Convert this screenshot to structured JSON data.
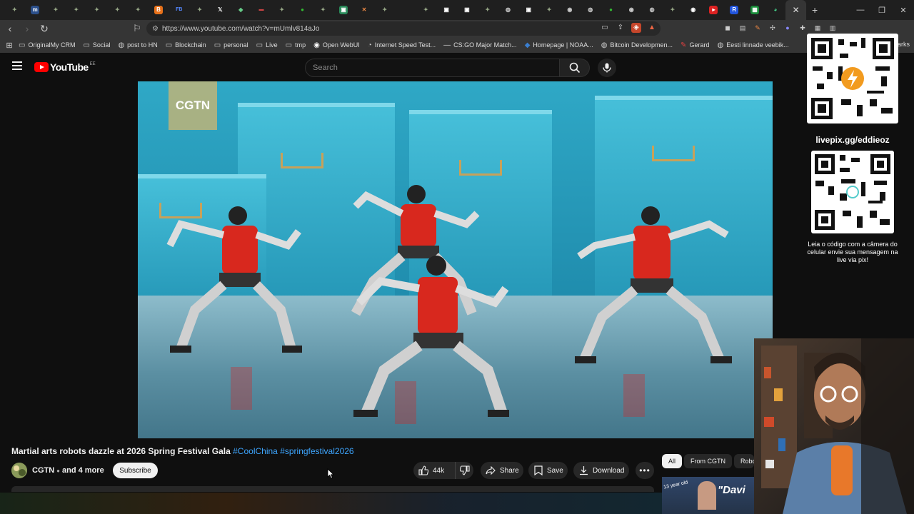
{
  "browser": {
    "url": "https://www.youtube.com/watch?v=mUmlv814aJo",
    "bookmarks": [
      {
        "label": "OriginalMy CRM",
        "icon": "folder-icon"
      },
      {
        "label": "Social",
        "icon": "folder-icon"
      },
      {
        "label": "post to HN",
        "icon": "globe-icon"
      },
      {
        "label": "Blockchain",
        "icon": "folder-icon"
      },
      {
        "label": "personal",
        "icon": "folder-icon"
      },
      {
        "label": "Live",
        "icon": "folder-icon"
      },
      {
        "label": "tmp",
        "icon": "folder-icon"
      },
      {
        "label": "Open WebUI",
        "icon": "openwebui-icon"
      },
      {
        "label": "Internet Speed Test...",
        "icon": "speedtest-icon"
      },
      {
        "label": "CS:GO Major Match...",
        "icon": "csgo-icon"
      },
      {
        "label": "Homepage | NOAA...",
        "icon": "noaa-icon"
      },
      {
        "label": "Bitcoin Developmen...",
        "icon": "globe-icon"
      },
      {
        "label": "Gerard",
        "icon": "feather-icon"
      },
      {
        "label": "Eesti linnade veebik...",
        "icon": "globe-icon"
      }
    ],
    "bookmarks_overflow": "marks"
  },
  "youtube": {
    "logo_text": "YouTube",
    "region": "EE",
    "search_placeholder": "Search",
    "video_watermark": "CGTN",
    "title_text": "Martial arts robots dazzle at 2026 Spring Festival Gala",
    "tags": [
      "#CoolChina",
      "#springfestival2026"
    ],
    "channel": "CGTN",
    "channel_more": "and 4 more",
    "subscribe_label": "Subscribe",
    "like_count": "44k",
    "share_label": "Share",
    "save_label": "Save",
    "download_label": "Download",
    "chips": [
      "All",
      "From CGTN",
      "Robo"
    ],
    "thumb_label": "13 year old",
    "thumb_text": "\"Davi"
  },
  "overlay": {
    "livepix_label": "livepix.gg/eddieoz",
    "livepix_caption": "Leia o código com a câmera do celular envie sua mensagem na live via pix!"
  }
}
